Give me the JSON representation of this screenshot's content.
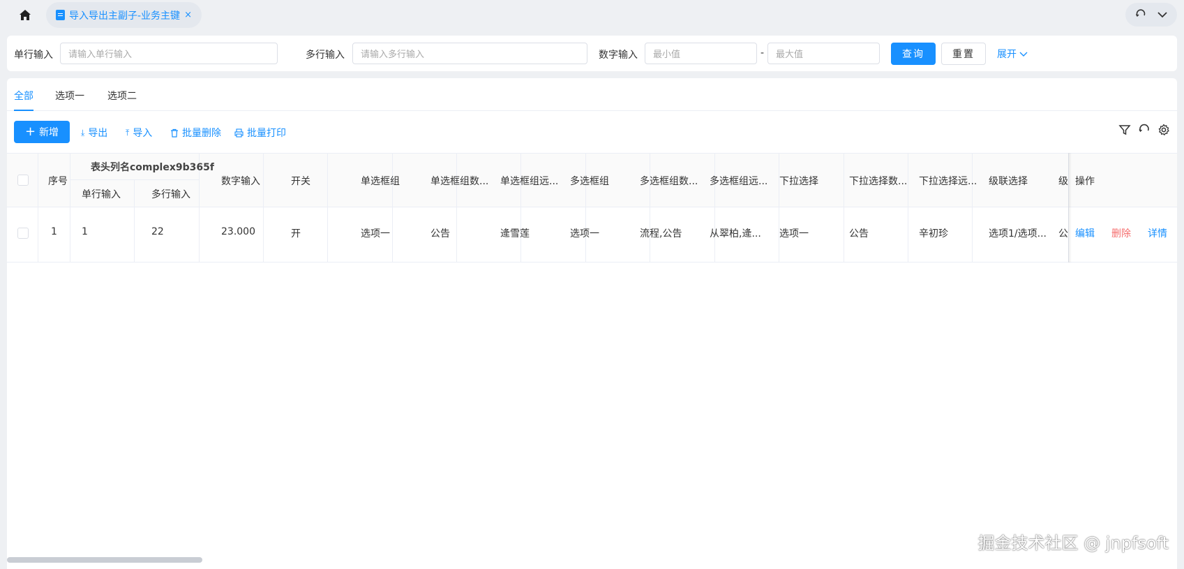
{
  "top_tabs": {
    "home_icon": "home-icon",
    "active_tab_label": "导入导出主副子-业务主键",
    "close_glyph": "×"
  },
  "search": {
    "single_label": "单行输入",
    "single_placeholder": "请输入单行输入",
    "multi_label": "多行输入",
    "multi_placeholder": "请输入多行输入",
    "number_label": "数字输入",
    "min_placeholder": "最小值",
    "range_sep": "-",
    "max_placeholder": "最大值",
    "query_label": "查询",
    "reset_label": "重置",
    "expand_label": "展开"
  },
  "tabs": [
    "全部",
    "选项一",
    "选项二"
  ],
  "toolbar": {
    "add_label": "新增",
    "export_label": "导出",
    "import_label": "导入",
    "batch_delete_label": "批量删除",
    "batch_print_label": "批量打印"
  },
  "table": {
    "headers": {
      "index": "序号",
      "group": "表头列名complex9b365f",
      "group_sub1": "单行输入",
      "group_sub2": "多行输入",
      "number": "数字输入",
      "switch": "开关",
      "radio": "单选框组",
      "radio_data": "单选框组数...",
      "radio_remote": "单选框组远...",
      "checkbox": "多选框组",
      "checkbox_data": "多选框组数...",
      "checkbox_remote": "多选框组远...",
      "select": "下拉选择",
      "select_data": "下拉选择数...",
      "select_remote": "下拉选择远...",
      "cascader": "级联选择",
      "cascader2": "级",
      "action": "操作"
    },
    "rows": [
      {
        "index": "1",
        "single": "1",
        "multi": "22",
        "number": "23.000",
        "switch": "开",
        "radio": "选项一",
        "radio_data": "公告",
        "radio_remote": "逄雪莲",
        "checkbox": "选项一",
        "checkbox_data": "流程,公告",
        "checkbox_remote": "从翠柏,逄...",
        "select": "选项一",
        "select_data": "公告",
        "select_remote": "辛初珍",
        "cascader": "选项1/选项...",
        "cascader2": "公"
      }
    ],
    "actions": {
      "edit": "编辑",
      "delete": "删除",
      "detail": "详情"
    }
  },
  "watermark": "掘金技术社区 @ jnpfsoft",
  "colors": {
    "primary": "#1890ff",
    "danger": "#f56c6c",
    "page_bg": "#eef0f3"
  }
}
